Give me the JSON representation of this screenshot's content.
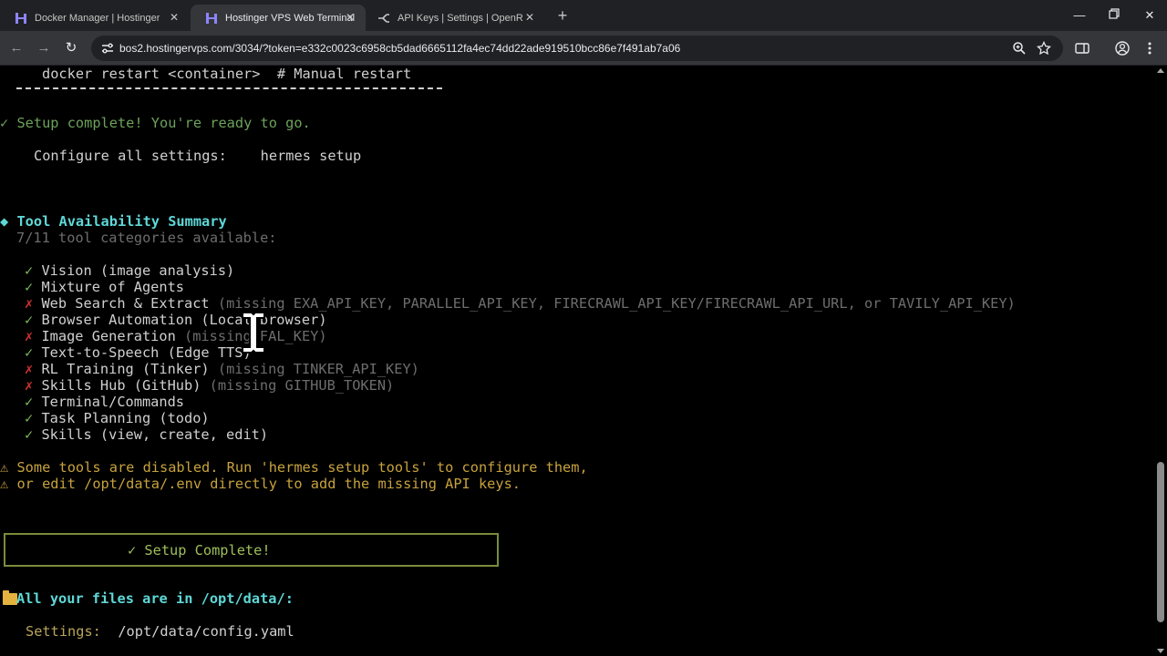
{
  "browser": {
    "tabs": [
      {
        "title": "Docker Manager | Hostinger",
        "favicon": "hostinger-logo-icon",
        "active": false
      },
      {
        "title": "Hostinger VPS Web Terminal",
        "favicon": "hostinger-logo-icon",
        "active": true
      },
      {
        "title": "API Keys | Settings | OpenRouter",
        "favicon": "openrouter-logo-icon",
        "active": false
      }
    ],
    "url": "bos2.hostingervps.com/3034/?token=e332c0023c6958cb5dad6665112fa4ec74dd22ade919510bcc86e7f491ab7a06"
  },
  "terminal": {
    "restart_cmd": "docker restart <container>",
    "restart_comment": "# Manual restart",
    "setup_complete_msg": "Setup complete! You're ready to go.",
    "configure_label": "Configure all settings:",
    "configure_cmd": "hermes setup",
    "summary_title": "Tool Availability Summary",
    "summary_count": "7/11 tool categories available:",
    "tools": [
      {
        "status": "ok",
        "name": "Vision (image analysis)",
        "note": ""
      },
      {
        "status": "ok",
        "name": "Mixture of Agents",
        "note": ""
      },
      {
        "status": "missing",
        "name": "Web Search & Extract",
        "note": "(missing EXA_API_KEY, PARALLEL_API_KEY, FIRECRAWL_API_KEY/FIRECRAWL_API_URL, or TAVILY_API_KEY)"
      },
      {
        "status": "ok",
        "name": "Browser Automation (Local browser)",
        "note": ""
      },
      {
        "status": "missing",
        "name": "Image Generation",
        "note": "(missing FAL_KEY)"
      },
      {
        "status": "ok",
        "name": "Text-to-Speech (Edge TTS)",
        "note": ""
      },
      {
        "status": "missing",
        "name": "RL Training (Tinker)",
        "note": "(missing TINKER_API_KEY)"
      },
      {
        "status": "missing",
        "name": "Skills Hub (GitHub)",
        "note": "(missing GITHUB_TOKEN)"
      },
      {
        "status": "ok",
        "name": "Terminal/Commands",
        "note": ""
      },
      {
        "status": "ok",
        "name": "Task Planning (todo)",
        "note": ""
      },
      {
        "status": "ok",
        "name": "Skills (view, create, edit)",
        "note": ""
      }
    ],
    "warning_1": "Some tools are disabled. Run 'hermes setup tools' to configure them,",
    "warning_2": "or edit /opt/data/.env directly to add the missing API keys.",
    "box_text": "✓ Setup Complete!",
    "files_title": "All your files are in /opt/data/:",
    "settings_label": "Settings:",
    "settings_path": "/opt/data/config.yaml"
  },
  "colors": {
    "success": "#6ca35b",
    "error": "#d0322d",
    "warning": "#c7a23d",
    "heading": "#5fd7d7",
    "box_border": "#7a8c3c"
  }
}
